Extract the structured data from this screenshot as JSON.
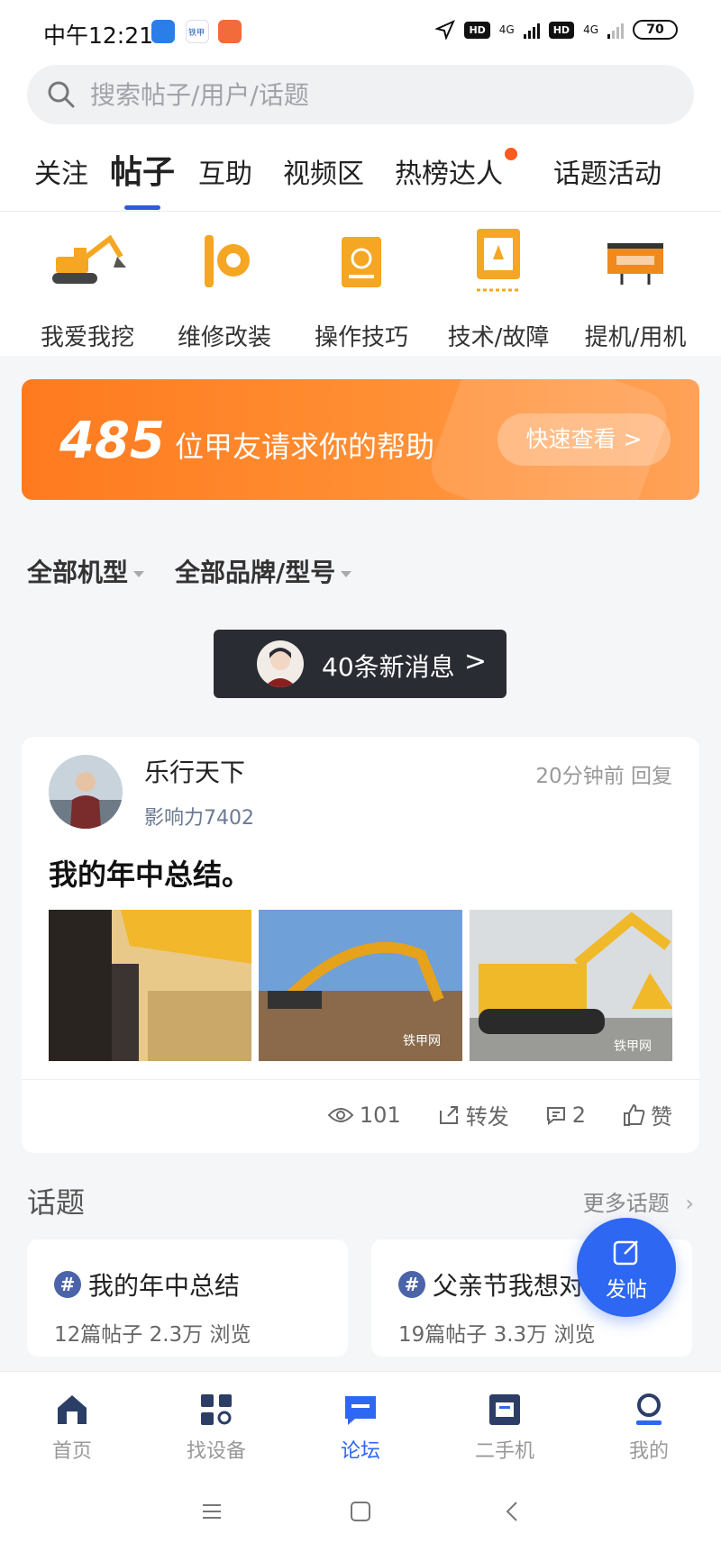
{
  "status_bar": {
    "time": "中午12:21",
    "badges": [
      "HD",
      "HD"
    ],
    "network": [
      "4G",
      "4G"
    ],
    "battery": "70"
  },
  "search": {
    "placeholder": "搜索帖子/用户/话题",
    "icon": "search-icon"
  },
  "tabs": [
    {
      "label": "关注"
    },
    {
      "label": "帖子",
      "active": true
    },
    {
      "label": "互助"
    },
    {
      "label": "视频区"
    },
    {
      "label": "热榜达人",
      "badge_dot": true
    },
    {
      "label": "话题活动"
    }
  ],
  "categories": [
    {
      "label": "我爱我挖",
      "icon": "excavator-icon"
    },
    {
      "label": "维修改装",
      "icon": "wrench-gear-icon"
    },
    {
      "label": "操作技巧",
      "icon": "manual-book-icon"
    },
    {
      "label": "技术/故障",
      "icon": "fault-diagnosis-icon"
    },
    {
      "label": "提机/用机",
      "icon": "usage-report-icon"
    }
  ],
  "banner": {
    "count": "485",
    "text": "位甲友请求你的帮助",
    "button": "快速查看 >"
  },
  "filters": [
    {
      "label": "全部机型"
    },
    {
      "label": "全部品牌/型号"
    }
  ],
  "new_messages": {
    "label": "40条新消息",
    "chevron": ">"
  },
  "post": {
    "author": "乐行天下",
    "influence": "影响力7402",
    "time": "20分钟前 回复",
    "title": "我的年中总结。",
    "watermark": "铁甲网",
    "views": "101",
    "share_label": "转发",
    "comments": "2",
    "like_label": "赞"
  },
  "topics": {
    "heading": "话题",
    "more": "更多话题",
    "hash_symbol": "#",
    "items": [
      {
        "title": "我的年中总结",
        "stats": "12篇帖子   2.3万 浏览"
      },
      {
        "title": "父亲节我想对",
        "stats": "19篇帖子   3.3万 浏览"
      }
    ]
  },
  "fab": {
    "label": "发帖"
  },
  "bottom_nav": [
    {
      "label": "首页",
      "icon": "home-icon"
    },
    {
      "label": "找设备",
      "icon": "find-device-icon"
    },
    {
      "label": "论坛",
      "icon": "forum-icon",
      "active": true
    },
    {
      "label": "二手机",
      "icon": "used-machine-icon"
    },
    {
      "label": "我的",
      "icon": "profile-icon"
    }
  ],
  "colors": {
    "accent": "#2d67f2",
    "banner_orange": "#ff7a1e",
    "tab_underline": "#2f5bd8",
    "dot": "#ff5a1f"
  }
}
